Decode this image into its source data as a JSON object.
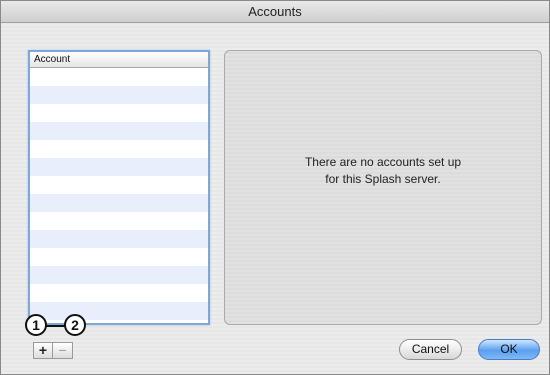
{
  "window": {
    "title": "Accounts"
  },
  "account_list": {
    "header": "Account"
  },
  "detail": {
    "empty_line1": "There are no accounts set up",
    "empty_line2": "for this Splash server."
  },
  "controls": {
    "add_label": "+",
    "remove_label": "−"
  },
  "callouts": {
    "one": "1",
    "two": "2"
  },
  "buttons": {
    "cancel": "Cancel",
    "ok": "OK"
  }
}
